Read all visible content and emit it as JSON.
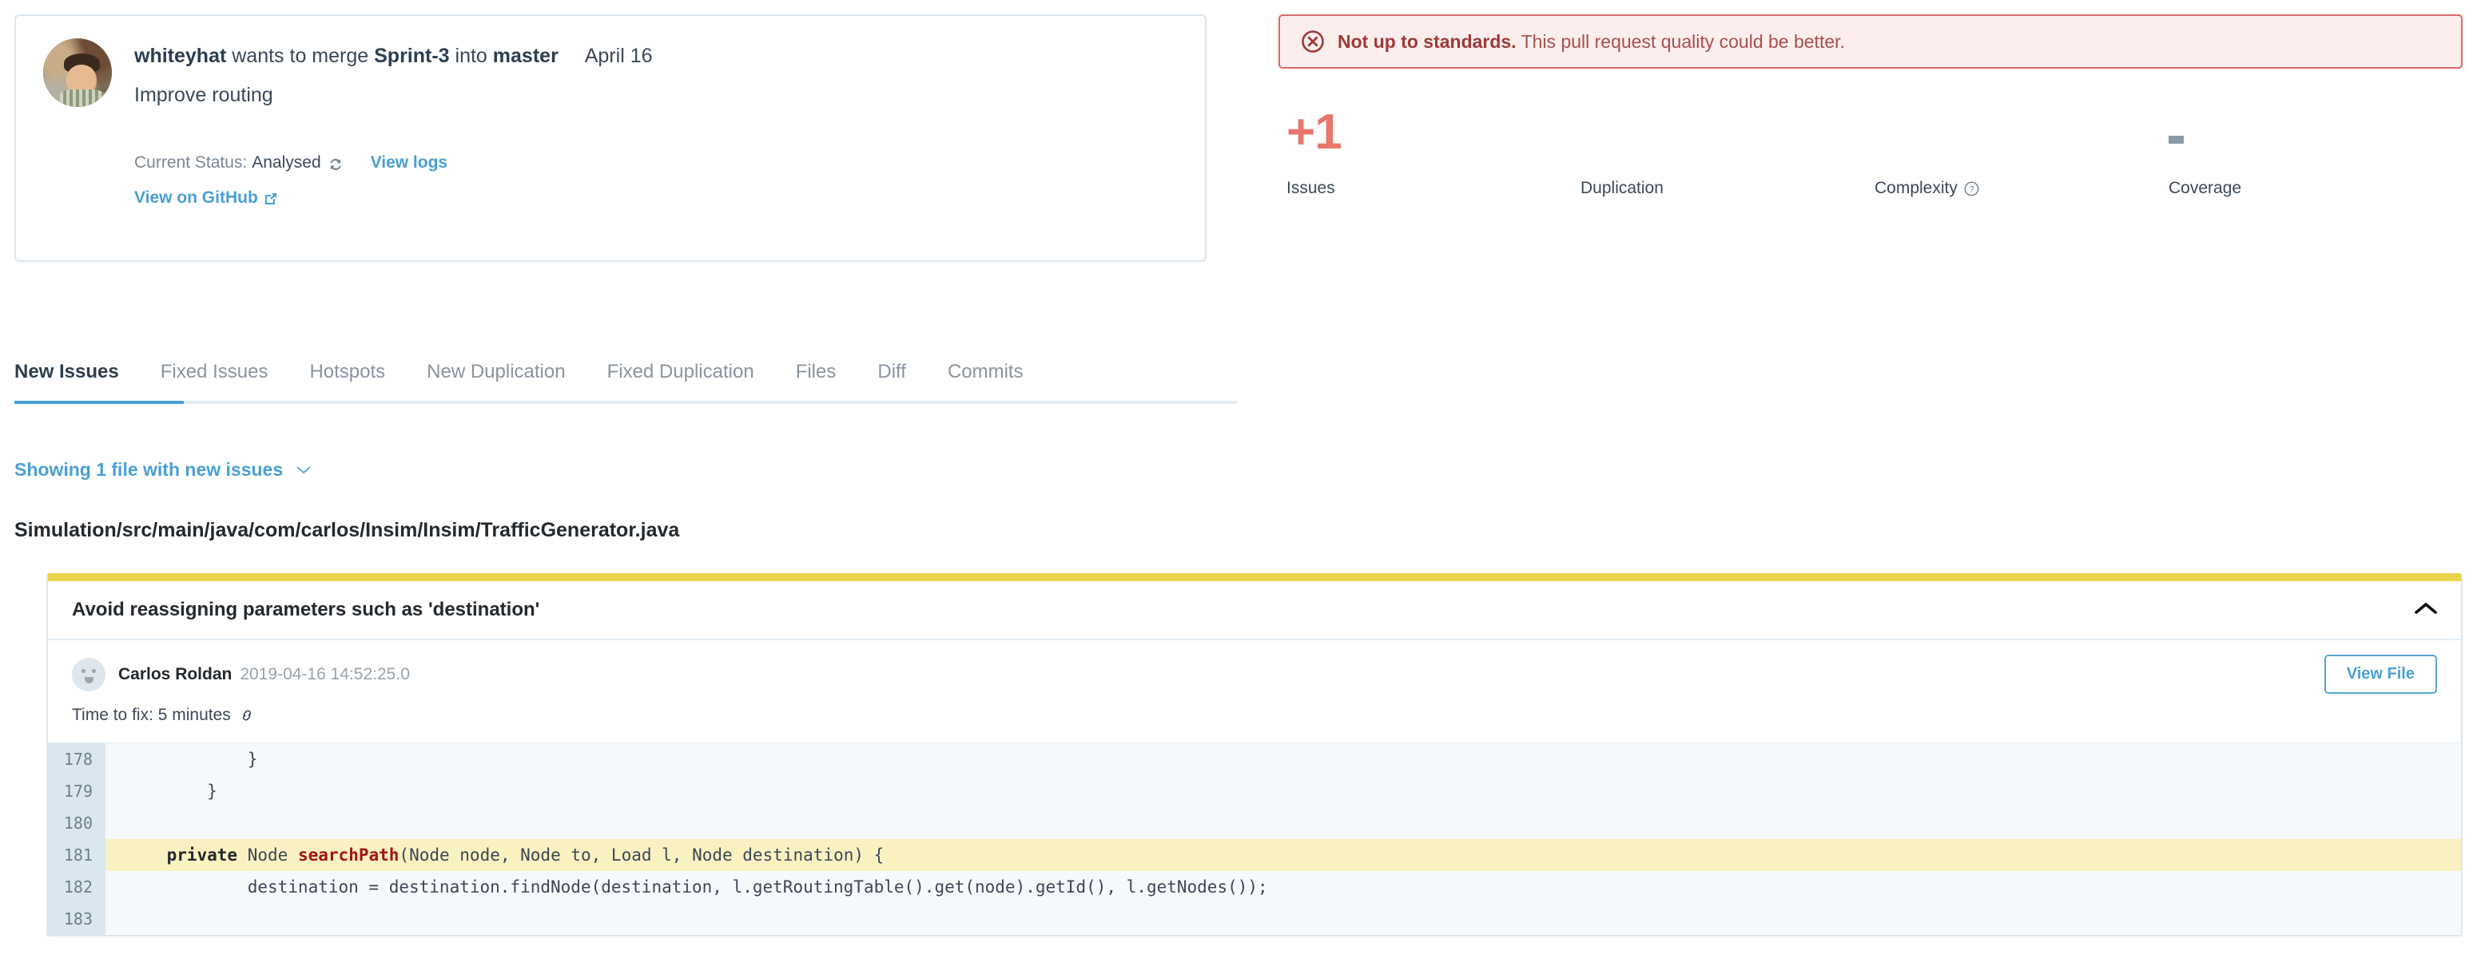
{
  "pull_request": {
    "author": "whiteyhat",
    "action_text": "wants to merge",
    "source_branch": "Sprint-3",
    "into_text": "into",
    "target_branch": "master",
    "date": "April 16",
    "title": "Improve routing",
    "status_label": "Current Status:",
    "status_value": "Analysed",
    "refresh_icon": "refresh-icon",
    "view_logs_label": "View logs",
    "view_github_label": "View on GitHub",
    "external_link_icon": "external-link-icon",
    "avatar_icon": "user-avatar"
  },
  "quality": {
    "alert": {
      "icon": "error-circle-icon",
      "headline": "Not up to standards.",
      "message": "This pull request quality could be better."
    },
    "accent_error_color": "#d96a68",
    "accent_link_color": "#4a9fd4",
    "metrics": [
      {
        "label": "Issues",
        "value": "+1",
        "kind": "delta",
        "icon": "plus-one-indicator",
        "has_help": false
      },
      {
        "label": "Duplication",
        "value": "=",
        "kind": "equal",
        "icon": "equals-icon",
        "has_help": false
      },
      {
        "label": "Complexity",
        "value": "=",
        "kind": "equal",
        "icon": "equals-icon",
        "has_help": true,
        "help_icon": "help-circle-icon"
      },
      {
        "label": "Coverage",
        "value": "-",
        "kind": "dash",
        "icon": "dash-icon",
        "has_help": false
      }
    ]
  },
  "tabs": [
    {
      "label": "New Issues",
      "active": true
    },
    {
      "label": "Fixed Issues",
      "active": false
    },
    {
      "label": "Hotspots",
      "active": false
    },
    {
      "label": "New Duplication",
      "active": false
    },
    {
      "label": "Fixed Duplication",
      "active": false
    },
    {
      "label": "Files",
      "active": false
    },
    {
      "label": "Diff",
      "active": false
    },
    {
      "label": "Commits",
      "active": false
    }
  ],
  "filter": {
    "showing_label": "Showing 1 file with new issues",
    "chevron_icon": "chevron-down-icon"
  },
  "file": {
    "path": "Simulation/src/main/java/com/carlos/Insim/Insim/TrafficGenerator.java"
  },
  "issue": {
    "severity_color": "#ead44c",
    "title": "Avoid reassigning parameters such as 'destination'",
    "collapse_icon": "chevron-up-icon",
    "author_name": "Carlos Roldan",
    "author_avatar": "default-avatar-icon",
    "timestamp": "2019-04-16 14:52:25.0",
    "view_file_label": "View File",
    "time_to_fix": "Time to fix: 5 minutes",
    "time_to_fix_icon": "chain-link-icon",
    "code": [
      {
        "number": "178",
        "text": "            }",
        "highlight": false
      },
      {
        "number": "179",
        "text": "        }",
        "highlight": false
      },
      {
        "number": "180",
        "text": "",
        "highlight": false
      },
      {
        "number": "181",
        "text": "    private Node searchPath(Node node, Node to, Load l, Node destination) {",
        "highlight": true
      },
      {
        "number": "182",
        "text": "            destination = destination.findNode(destination, l.getRoutingTable().get(node).getId(), l.getNodes());",
        "highlight": false
      },
      {
        "number": "183",
        "text": "",
        "highlight": false
      }
    ]
  }
}
